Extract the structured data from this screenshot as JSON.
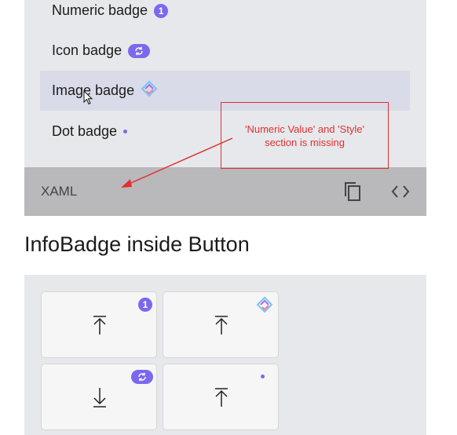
{
  "list": {
    "items": [
      {
        "label": "Numeric badge",
        "badge": "1"
      },
      {
        "label": "Icon badge",
        "badge_icon": "sync-icon"
      },
      {
        "label": "Image badge",
        "badge_icon": "image-badge-icon"
      },
      {
        "label": "Dot badge",
        "badge_icon": "dot"
      }
    ]
  },
  "footer": {
    "xaml_label": "XAML",
    "copy_icon": "copy-icon",
    "code_icon": "code-icon"
  },
  "annotation": {
    "text": "'Numeric Value' and 'Style' section is missing",
    "color": "#e03030"
  },
  "section2": {
    "title": "InfoBadge inside Button",
    "buttons": [
      {
        "glyph": "upload-icon",
        "badge": "1"
      },
      {
        "glyph": "upload-icon",
        "badge_icon": "image-badge-icon"
      },
      {
        "glyph": "download-icon",
        "badge_icon": "sync-icon"
      },
      {
        "glyph": "upload-icon",
        "badge_icon": "dot"
      }
    ]
  },
  "colors": {
    "accent": "#7b68ee",
    "panel": "#e6e8eb",
    "footer": "#b9b8bb",
    "selected": "#d9dbe9"
  }
}
